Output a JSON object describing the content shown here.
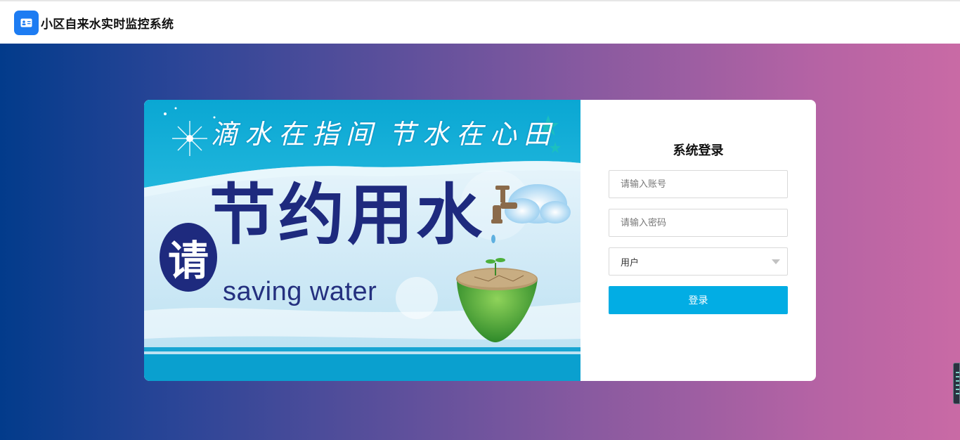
{
  "header": {
    "title": "小区自来水实时监控系统"
  },
  "banner": {
    "slogan_left": "滴水在指间",
    "slogan_right": "节水在心田",
    "main": "节约用水",
    "please": "请",
    "english": "saving water"
  },
  "login": {
    "title": "系统登录",
    "account_placeholder": "请输入账号",
    "password_placeholder": "请输入密码",
    "role_selected": "用户",
    "submit_label": "登录"
  },
  "colors": {
    "accent": "#02ade4",
    "logo": "#1d7cf2",
    "banner_text": "#1e2a7e"
  }
}
